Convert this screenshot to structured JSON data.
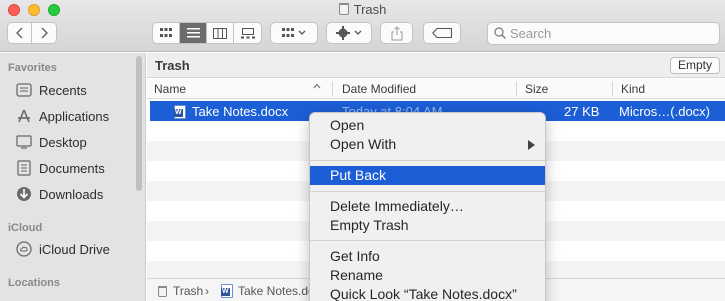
{
  "window": {
    "title": "Trash"
  },
  "toolbar": {
    "back_icon": "chevron-left-icon",
    "forward_icon": "chevron-right-icon",
    "view_modes": [
      "icon-view-icon",
      "list-view-icon",
      "column-view-icon",
      "gallery-view-icon"
    ],
    "active_view": "list",
    "group_icon": "group-grid-icon",
    "action_icon": "gear-icon",
    "share_icon": "share-icon",
    "tag_icon": "tag-icon"
  },
  "search": {
    "placeholder": "Search"
  },
  "sidebar": {
    "favorites_label": "Favorites",
    "favorites": [
      {
        "label": "Recents",
        "icon": "clock-icon"
      },
      {
        "label": "Applications",
        "icon": "applications-icon"
      },
      {
        "label": "Desktop",
        "icon": "desktop-icon"
      },
      {
        "label": "Documents",
        "icon": "document-icon"
      },
      {
        "label": "Downloads",
        "icon": "download-icon"
      }
    ],
    "icloud_label": "iCloud",
    "icloud": [
      {
        "label": "iCloud Drive",
        "icon": "cloud-icon"
      }
    ],
    "locations_label": "Locations"
  },
  "main": {
    "location": "Trash",
    "empty_button": "Empty",
    "columns": [
      "Name",
      "Date Modified",
      "Size",
      "Kind"
    ],
    "files": [
      {
        "name": "Take Notes.docx",
        "date": "Today at 8:04 AM",
        "size": "27 KB",
        "kind": "Micros…(.docx)",
        "selected": true
      }
    ],
    "pathbar": [
      "Trash",
      "Take Notes.do"
    ]
  },
  "context_menu": {
    "items": [
      {
        "label": "Open"
      },
      {
        "label": "Open With",
        "submenu": true
      },
      {
        "label": "Put Back",
        "highlighted": true
      },
      {
        "label": "Delete Immediately…"
      },
      {
        "label": "Empty Trash"
      },
      {
        "label": "Get Info"
      },
      {
        "label": "Rename"
      },
      {
        "label": "Quick Look “Take Notes.docx”"
      }
    ]
  },
  "colors": {
    "selection": "#1c5ed6",
    "sidebar_bg": "#e4e2e4"
  }
}
